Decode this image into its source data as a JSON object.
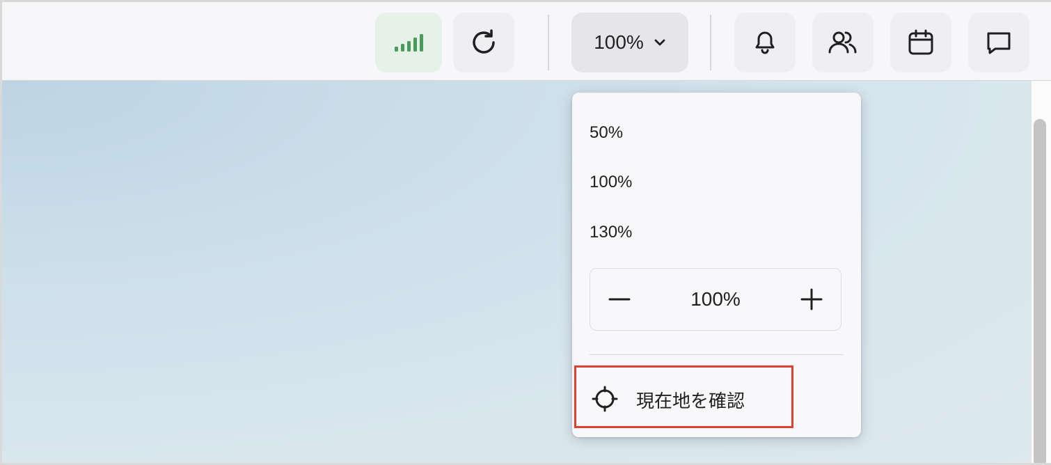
{
  "toolbar": {
    "signal_icon": "signal-bars-icon",
    "refresh_icon": "refresh-icon",
    "zoom_label": "100%",
    "zoom_chevron_icon": "chevron-down-icon",
    "bell_icon": "bell-icon",
    "people_icon": "people-icon",
    "calendar_icon": "calendar-icon",
    "chat_icon": "chat-icon",
    "signal_color": "#4a9a5a"
  },
  "zoom_menu": {
    "options": [
      "50%",
      "100%",
      "130%"
    ],
    "stepper": {
      "minus_icon": "minus-icon",
      "value": "100%",
      "plus_icon": "plus-icon"
    },
    "locate": {
      "icon": "crosshair-icon",
      "label": "現在地を確認",
      "highlight_color": "#e04030"
    }
  }
}
